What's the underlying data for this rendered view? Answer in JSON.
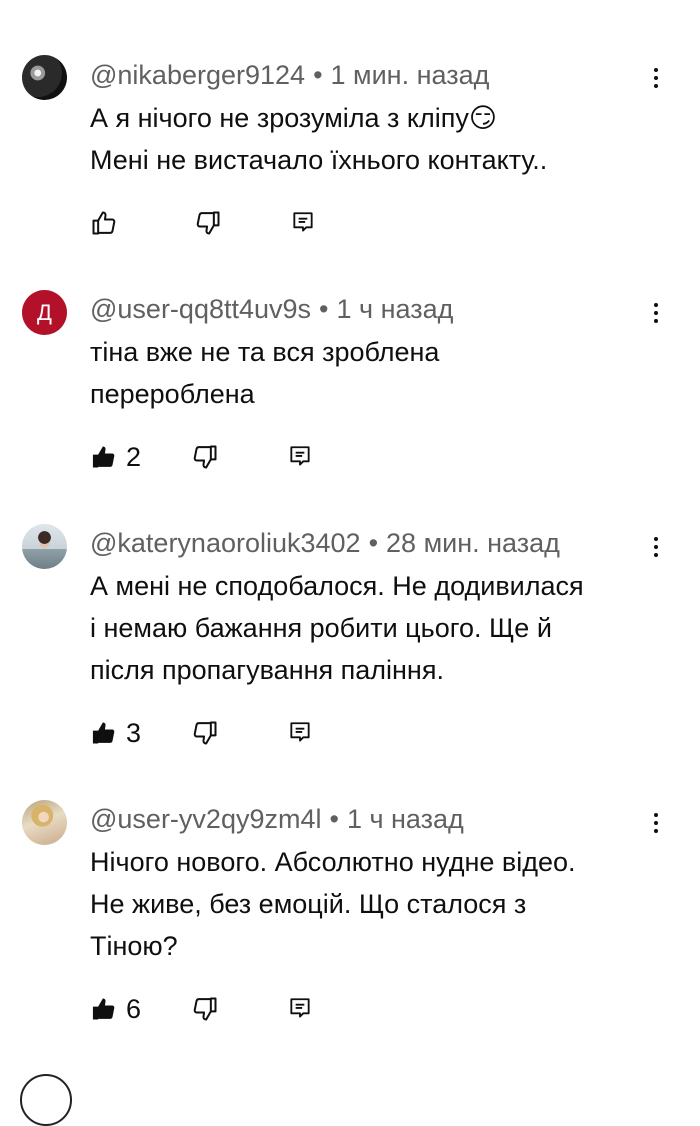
{
  "comments": [
    {
      "author": "@nikaberger9124",
      "separator": "•",
      "time": "1 мин. назад",
      "lines": [
        "А я нічого не зрозуміла з кліпу😏",
        "Мені не вистачало їхнього контакту.."
      ],
      "likes": "",
      "avatar_letter": ""
    },
    {
      "author": "@user-qq8tt4uv9s",
      "separator": "•",
      "time": "1 ч назад",
      "lines": [
        "тіна вже не та вся зроблена",
        "перероблена"
      ],
      "likes": "2",
      "avatar_letter": "Д"
    },
    {
      "author": "@katerynaoroliuk3402",
      "separator": "•",
      "time": "28 мин. назад",
      "lines": [
        "А мені не сподобалося. Не додивилася",
        "і немаю бажання робити цього. Ще й",
        "після пропагування паління."
      ],
      "likes": "3",
      "avatar_letter": ""
    },
    {
      "author": "@user-yv2qy9zm4l",
      "separator": "•",
      "time": "1 ч назад",
      "lines": [
        "Нічого нового. Абсолютно нудне відео.",
        "Не живе, без емоцій. Що сталося з",
        "Тіною?"
      ],
      "likes": "6",
      "avatar_letter": ""
    }
  ],
  "icons": {
    "like": "thumbs-up-icon",
    "dislike": "thumbs-down-icon",
    "reply": "reply-icon",
    "menu": "more-vert-icon"
  },
  "colors": {
    "text": "#0f0f0f",
    "meta": "#606060",
    "avatar_letter_bg": "#b3102a"
  }
}
